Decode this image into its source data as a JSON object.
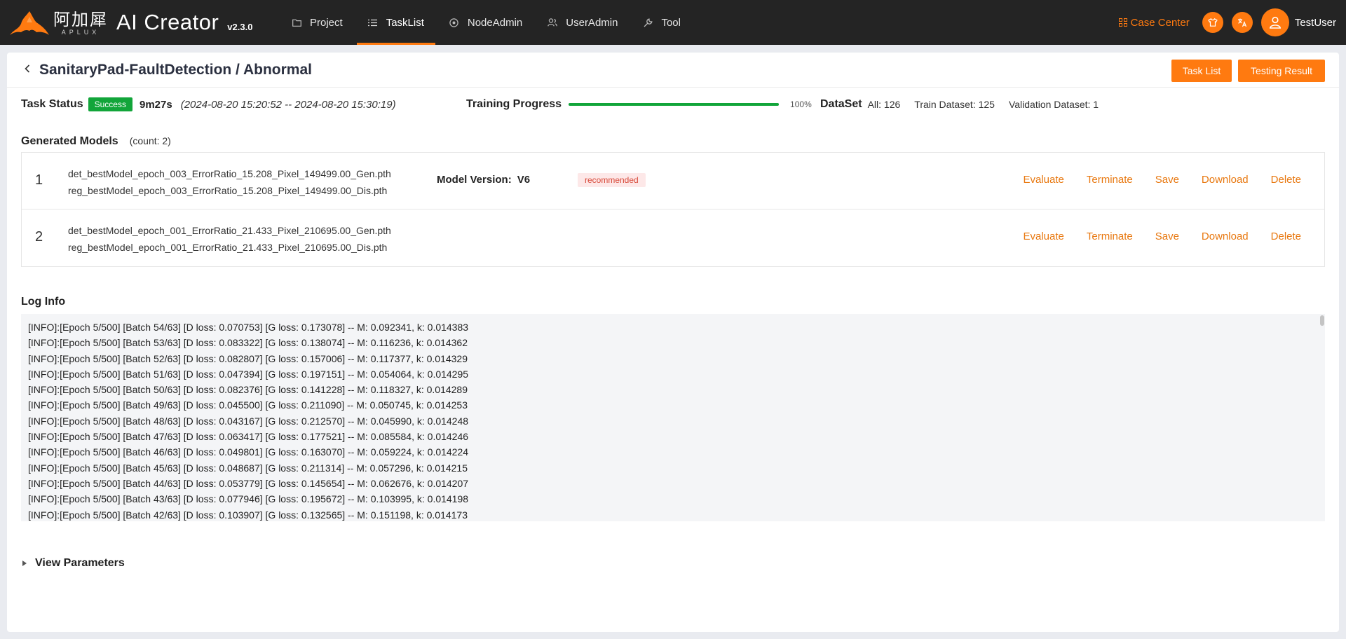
{
  "brand": {
    "cn": "阿加犀",
    "en": "APLUX",
    "name": "AI Creator",
    "version": "v2.3.0"
  },
  "nav": [
    {
      "label": "Project",
      "icon": "folder-icon"
    },
    {
      "label": "TaskList",
      "icon": "list-icon",
      "active": true
    },
    {
      "label": "NodeAdmin",
      "icon": "node-icon"
    },
    {
      "label": "UserAdmin",
      "icon": "users-icon"
    },
    {
      "label": "Tool",
      "icon": "wrench-icon"
    }
  ],
  "topright": {
    "case_center": "Case Center",
    "username": "TestUser"
  },
  "page": {
    "title": "SanitaryPad-FaultDetection / Abnormal",
    "task_list_btn": "Task List",
    "testing_result_btn": "Testing Result"
  },
  "status": {
    "task_status_label": "Task Status",
    "status_tag": "Success",
    "duration": "9m27s",
    "time_range": "(2024-08-20 15:20:52 -- 2024-08-20 15:30:19)",
    "training_progress_label": "Training Progress",
    "progress_value": 100,
    "progress_text": "100%",
    "dataset_label": "DataSet",
    "dataset_all": "All: 126",
    "dataset_train": "Train Dataset: 125",
    "dataset_validation": "Validation Dataset: 1"
  },
  "models": {
    "title": "Generated Models",
    "count_text": "(count:  2)",
    "actions": [
      "Evaluate",
      "Terminate",
      "Save",
      "Download",
      "Delete"
    ],
    "rows": [
      {
        "index": "1",
        "file1": "det_bestModel_epoch_003_ErrorRatio_15.208_Pixel_149499.00_Gen.pth",
        "file2": "reg_bestModel_epoch_003_ErrorRatio_15.208_Pixel_149499.00_Dis.pth",
        "version_label": "Model Version:",
        "version": "V6",
        "tag": "recommended"
      },
      {
        "index": "2",
        "file1": "det_bestModel_epoch_001_ErrorRatio_21.433_Pixel_210695.00_Gen.pth",
        "file2": "reg_bestModel_epoch_001_ErrorRatio_21.433_Pixel_210695.00_Dis.pth"
      }
    ]
  },
  "log": {
    "title": "Log Info",
    "lines": [
      "[INFO]:[Epoch 5/500] [Batch 54/63] [D loss: 0.070753] [G loss: 0.173078] -- M: 0.092341, k: 0.014383",
      "[INFO]:[Epoch 5/500] [Batch 53/63] [D loss: 0.083322] [G loss: 0.138074] -- M: 0.116236, k: 0.014362",
      "[INFO]:[Epoch 5/500] [Batch 52/63] [D loss: 0.082807] [G loss: 0.157006] -- M: 0.117377, k: 0.014329",
      "[INFO]:[Epoch 5/500] [Batch 51/63] [D loss: 0.047394] [G loss: 0.197151] -- M: 0.054064, k: 0.014295",
      "[INFO]:[Epoch 5/500] [Batch 50/63] [D loss: 0.082376] [G loss: 0.141228] -- M: 0.118327, k: 0.014289",
      "[INFO]:[Epoch 5/500] [Batch 49/63] [D loss: 0.045500] [G loss: 0.211090] -- M: 0.050745, k: 0.014253",
      "[INFO]:[Epoch 5/500] [Batch 48/63] [D loss: 0.043167] [G loss: 0.212570] -- M: 0.045990, k: 0.014248",
      "[INFO]:[Epoch 5/500] [Batch 47/63] [D loss: 0.063417] [G loss: 0.177521] -- M: 0.085584, k: 0.014246",
      "[INFO]:[Epoch 5/500] [Batch 46/63] [D loss: 0.049801] [G loss: 0.163070] -- M: 0.059224, k: 0.014224",
      "[INFO]:[Epoch 5/500] [Batch 45/63] [D loss: 0.048687] [G loss: 0.211314] -- M: 0.057296, k: 0.014215",
      "[INFO]:[Epoch 5/500] [Batch 44/63] [D loss: 0.053779] [G loss: 0.145654] -- M: 0.062676, k: 0.014207",
      "[INFO]:[Epoch 5/500] [Batch 43/63] [D loss: 0.077946] [G loss: 0.195672] -- M: 0.103995, k: 0.014198",
      "[INFO]:[Epoch 5/500] [Batch 42/63] [D loss: 0.103907] [G loss: 0.132565] -- M: 0.151198, k: 0.014173"
    ]
  },
  "params": {
    "label": "View Parameters"
  },
  "colors": {
    "accent": "#ff7a10",
    "success": "#12a53a",
    "topbar": "#242424",
    "action": "#e8770e"
  }
}
